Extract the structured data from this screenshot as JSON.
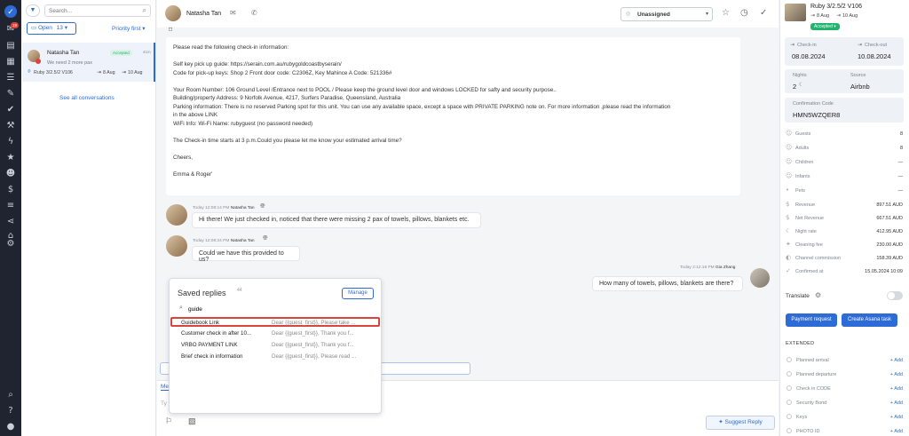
{
  "sidebar": {
    "notification_badge": "19"
  },
  "conversations": {
    "search_placeholder": "Search...",
    "filter_status": "Open",
    "filter_count": "13",
    "sort_label": "Priority first",
    "items": [
      {
        "name": "Natasha Tan",
        "status": "Accepted",
        "time": "41m",
        "preview": "We need 2 more pax",
        "property": "Ruby 3/2.5/2 V106",
        "checkin": "8 Aug",
        "checkout": "10 Aug"
      }
    ],
    "see_all": "See all conversations"
  },
  "chat": {
    "header_name": "Natasha Tan",
    "assignee": "Unassigned",
    "message_lines": [
      "Please read the following check-in information:",
      "",
      "Self key pick up guide: https://serain.com.au/rubygoldcoastbyserain/",
      "Code for pick-up keys: Shop 2 Front door code: C2306Z, Key Mahince A Code: 521336#",
      "",
      "Your Room Number: 106 Ground Level /Entrance next to POOL / Please keep the ground level door and windows LOCKED for safty and security purpose..",
      "Building/property Address: 9 Norfolk Avenue, 4217, Surfers Paradise, Queensland, Australia",
      "Parking information: There is no reserved Parking spot for this unit. You can use any available space, except a space with PRIVATE PARKING note on. For more information ,please read the information",
      "in the above LINK",
      "WiFi Info: Wi-Fi Name: rubyguest (no password needed)",
      "",
      "The Check-in time starts at 3 p.m.Could you please let me know your estimated arrival time?",
      "",
      "Cheers,",
      "",
      "Emma & Roger'"
    ],
    "messages": [
      {
        "meta_time": "Today 12:08:14 PM",
        "meta_author": "Natasha Tan",
        "text": "Hi there! We just checked in, noticed that there were missing 2 pax of towels, pillows, blankets etc."
      },
      {
        "meta_time": "Today 12:08:24 PM",
        "meta_author": "Natasha Tan",
        "text": "Could we have this provided to us?"
      },
      {
        "meta_time": "Today 2:12:18 PM",
        "meta_author": "Gia Zhang",
        "text": "How many of towels, pillows, blankets are there?"
      }
    ],
    "saved_replies": {
      "title": "Saved replies",
      "count": "44",
      "manage_label": "Manage",
      "search_value": "guide",
      "rows": [
        {
          "name": "Guidebook Link",
          "preview": "Dear {{guest_first}}, Please take ..."
        },
        {
          "name": "Customer check in after 10...",
          "preview": "Dear {{guest_first}}, Thank you f..."
        },
        {
          "name": "VRBO PAYMENT LINK",
          "preview": "Dear {{guest_first}}, Thank you f..."
        },
        {
          "name": "Brief check in information",
          "preview": "Dear {{guest_first}}, Please read ..."
        }
      ]
    },
    "compose_tab_partial": "Me",
    "compose_placeholder_partial": "Ty",
    "suggest_reply_label": "Suggest Reply"
  },
  "details": {
    "property_name": "Ruby 3/2.5/2 V106",
    "checkin_short": "8 Aug",
    "checkout_short": "10 Aug",
    "status_badge": "Accepted",
    "checkin_label": "Check-in",
    "checkin_value": "08.08.2024",
    "checkout_label": "Check-out",
    "checkout_value": "10.08.2024",
    "nights_label": "Nights",
    "nights_value": "2",
    "source_label": "Source",
    "source_value": "Airbnb",
    "confirmation_label": "Confirmation Code",
    "confirmation_value": "HMN5WZQER8",
    "rows": [
      {
        "label": "Guests",
        "value": "8",
        "icon": "☺"
      },
      {
        "label": "Adults",
        "value": "8",
        "icon": "☺"
      },
      {
        "label": "Children",
        "value": "—",
        "icon": "☺"
      },
      {
        "label": "Infants",
        "value": "—",
        "icon": "☺"
      },
      {
        "label": "Pets",
        "value": "—",
        "icon": "•"
      },
      {
        "label": "Revenue",
        "value": "897.51 AUD",
        "icon": "$"
      },
      {
        "label": "Net Revenue",
        "value": "667.51 AUD",
        "icon": "$"
      },
      {
        "label": "Night rate",
        "value": "412.95 AUD",
        "icon": "☾"
      },
      {
        "label": "Cleaning fee",
        "value": "230.00 AUD",
        "icon": "✦"
      },
      {
        "label": "Channel commission",
        "value": "158.39 AUD",
        "icon": "◐"
      },
      {
        "label": "Confirmed at",
        "value": "15.05.2024 10:09",
        "icon": "✓"
      }
    ],
    "translate_label": "Translate",
    "payment_request_label": "Payment request",
    "asana_task_label": "Create Asana task",
    "extended_title": "EXTENDED",
    "extended_rows": [
      "Planned arrival",
      "Planned departure",
      "Check in CODE",
      "Security Bond",
      "Keys",
      "PHOTO ID"
    ],
    "add_label": "+ Add"
  },
  "colors": {
    "accent": "#2d6bd6",
    "sidebar": "#1f2430",
    "accepted": "#21b36b",
    "highlight": "#d9453b"
  }
}
